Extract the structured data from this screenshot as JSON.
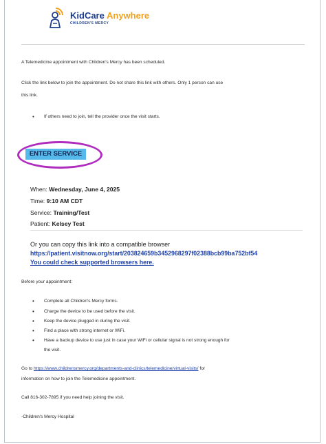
{
  "logo": {
    "brand_main": "KidCare",
    "brand_accent": "Anywhere",
    "brand_sub": "CHILDREN'S MERCY",
    "colors": {
      "navy": "#1d3e8e",
      "orange": "#f0a21b"
    }
  },
  "intro": "A Telemedicine appointment with Children's Mercy has been scheduled.",
  "click_instructions": {
    "line1": "Click the link below to join the appointment. Do not share this link with others. Only 1 person can use",
    "line2": "this link."
  },
  "others_bullet": "If others need to join, tell the provider once the visit starts.",
  "enter_button": {
    "label": "ENTER SERVICE",
    "bg_color": "#55b9ec",
    "highlight_color": "#b02cbf"
  },
  "details": {
    "when_label": "When:",
    "when_value": "Wednesday, June 4, 2025",
    "time_label": "Time:",
    "time_value": "9:10 AM CDT",
    "service_label": "Service:",
    "service_value": "Training/Test",
    "patient_label": "Patient:",
    "patient_value": "Kelsey Test"
  },
  "copy_link": {
    "text": "Or you can copy this link into a compatible browser",
    "url": "https://patient.visitnow.org/start/203824659b3452968297f02388bcb99ba752bf54",
    "browsers_link": "You could check supported browsers here."
  },
  "before": {
    "heading": "Before your appointment:",
    "items": [
      "Complete all Children's Mercy forms.",
      "Charge the device to be used before the visit.",
      "Keep the device plugged in during the visit.",
      "Find a place with strong internet or WiFi.",
      "Have a backup device to use just in case your WiFi or cellular signal is not strong enough for"
    ],
    "item5_cont": "the visit."
  },
  "goto": {
    "prefix": "Go to",
    "link": "https://www.childrensmercy.org/departments-and-clinics/telemedicine/virtual-visits/",
    "suffix": "for",
    "line2": "information on how to join the Telemedicine appointment."
  },
  "call_text": "Call 816-302-7895 if you need help joining the visit.",
  "signature": "-Children's Mercy Hospital"
}
